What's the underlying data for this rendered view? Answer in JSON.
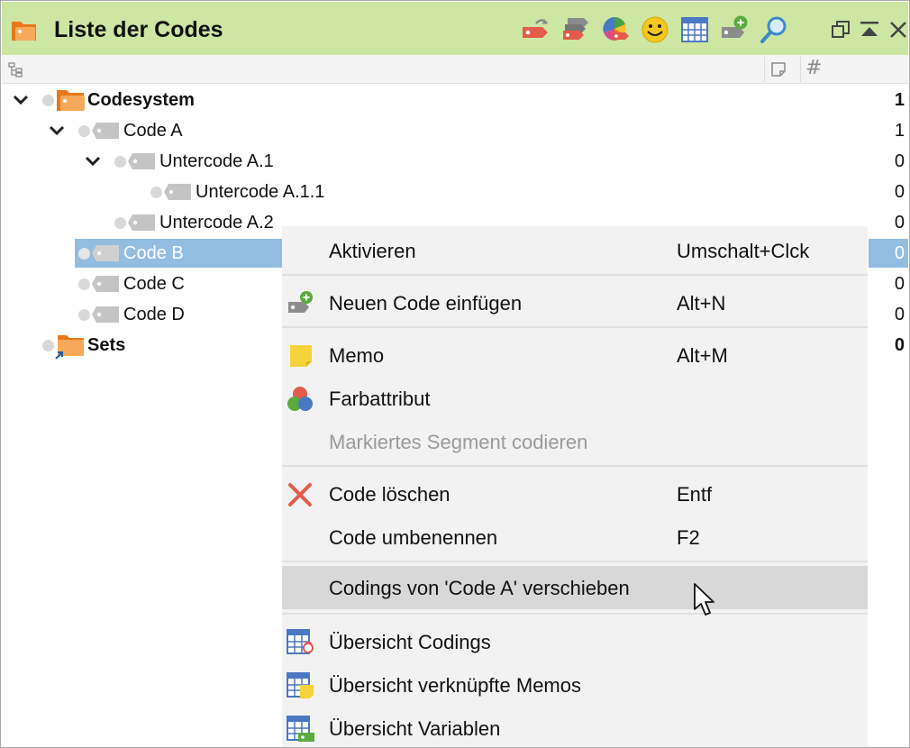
{
  "window": {
    "title": "Liste der Codes",
    "accent": "#cde6a4",
    "selection_color": "#93bde0",
    "toolbar_icons": [
      "code-return-icon",
      "code-stack-icon",
      "color-palette-icon",
      "smiley-icon",
      "table-grid-icon",
      "new-code-icon",
      "search-icon"
    ],
    "window_controls": [
      "restore-icon",
      "collapse-icon",
      "close-icon"
    ]
  },
  "columns": {
    "tree_icon": "tree-structure-icon",
    "memo_icon": "memo-column-icon",
    "count_symbol": "#"
  },
  "tree": [
    {
      "label": "Codesystem",
      "count": "1",
      "bold": true,
      "level": 0,
      "expanded": true,
      "icon": "codesystem-icon"
    },
    {
      "label": "Code A",
      "count": "1",
      "bold": false,
      "level": 1,
      "expanded": true,
      "icon": "code-tag-icon"
    },
    {
      "label": "Untercode A.1",
      "count": "0",
      "bold": false,
      "level": 2,
      "expanded": true,
      "icon": "code-tag-icon"
    },
    {
      "label": "Untercode A.1.1",
      "count": "0",
      "bold": false,
      "level": 3,
      "expanded": false,
      "icon": "code-tag-icon"
    },
    {
      "label": "Untercode A.2",
      "count": "0",
      "bold": false,
      "level": 2,
      "expanded": false,
      "icon": "code-tag-icon"
    },
    {
      "label": "Code B",
      "count": "0",
      "bold": false,
      "level": 1,
      "expanded": false,
      "selected": true,
      "icon": "code-tag-icon"
    },
    {
      "label": "Code C",
      "count": "0",
      "bold": false,
      "level": 1,
      "expanded": false,
      "icon": "code-tag-icon"
    },
    {
      "label": "Code D",
      "count": "0",
      "bold": false,
      "level": 1,
      "expanded": false,
      "icon": "code-tag-icon"
    },
    {
      "label": "Sets",
      "count": "0",
      "bold": true,
      "level": 0,
      "expanded": false,
      "icon": "sets-folder-icon"
    }
  ],
  "context_menu": {
    "items": [
      {
        "label": "Aktivieren",
        "shortcut": "Umschalt+Clck",
        "icon": ""
      },
      {
        "label": "Neuen Code einfügen",
        "shortcut": "Alt+N",
        "icon": "new-code-icon"
      },
      {
        "label": "Memo",
        "shortcut": "Alt+M",
        "icon": "memo-icon"
      },
      {
        "label": "Farbattribut",
        "shortcut": "",
        "icon": "color-attribute-icon"
      },
      {
        "label": "Markiertes Segment codieren",
        "shortcut": "",
        "icon": "",
        "disabled": true
      },
      {
        "label": "Code löschen",
        "shortcut": "Entf",
        "icon": "delete-x-icon"
      },
      {
        "label": "Code umbenennen",
        "shortcut": "F2",
        "icon": ""
      },
      {
        "label": "Codings von 'Code A' verschieben",
        "shortcut": "",
        "icon": "",
        "hover": true
      },
      {
        "label": "Übersicht Codings",
        "shortcut": "",
        "icon": "overview-codings-icon"
      },
      {
        "label": "Übersicht verknüpfte Memos",
        "shortcut": "",
        "icon": "overview-memos-icon"
      },
      {
        "label": "Übersicht Variablen",
        "shortcut": "",
        "icon": "overview-variables-icon"
      }
    ]
  }
}
